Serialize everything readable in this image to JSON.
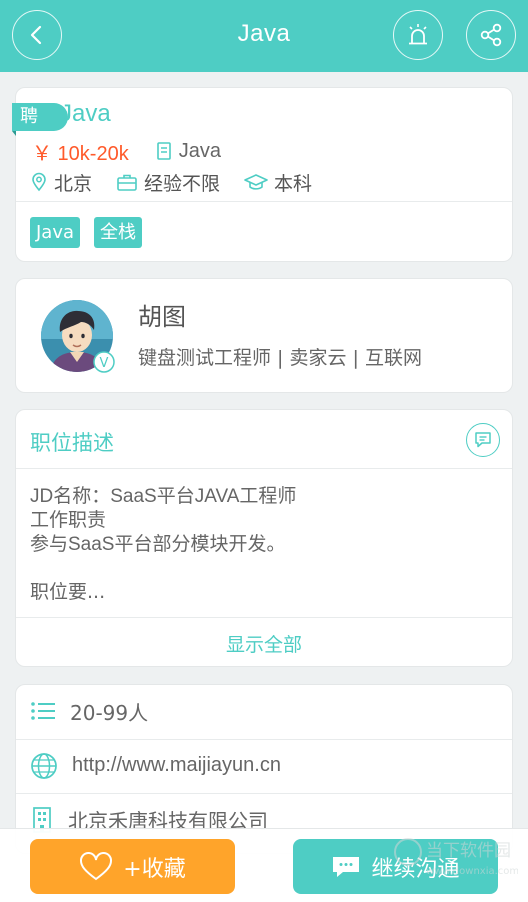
{
  "header": {
    "title": "Java",
    "back_icon": "chevron-left-icon",
    "alarm_icon": "alarm-icon",
    "share_icon": "share-icon"
  },
  "job": {
    "badge": "聘",
    "title": "Java",
    "salary": "￥ 10k-20k",
    "category": "Java",
    "location": "北京",
    "experience": "经验不限",
    "education": "本科",
    "tags": [
      "Java",
      "全栈"
    ]
  },
  "recruiter": {
    "name": "胡图",
    "info": "键盘测试工程师 | 卖家云 | 互联网",
    "verified_badge": "V"
  },
  "description": {
    "header": "职位描述",
    "lines": [
      "JD名称：SaaS平台JAVA工程师",
      "工作职责",
      "参与SaaS平台部分模块开发。"
    ],
    "more": "职位要...",
    "show_all": "显示全部"
  },
  "company": {
    "size": "20-99人",
    "website": "http://www.maijiayun.cn",
    "name": "北京禾唐科技有限公司"
  },
  "actions": {
    "favorite_label": "+收藏",
    "chat_label": "继续沟通"
  },
  "watermark": {
    "text": "当下软件园",
    "url": "www.downxia.com"
  },
  "colors": {
    "primary": "#4ecdc4",
    "salary": "#ff5a2b",
    "favorite": "#ffa42a"
  }
}
